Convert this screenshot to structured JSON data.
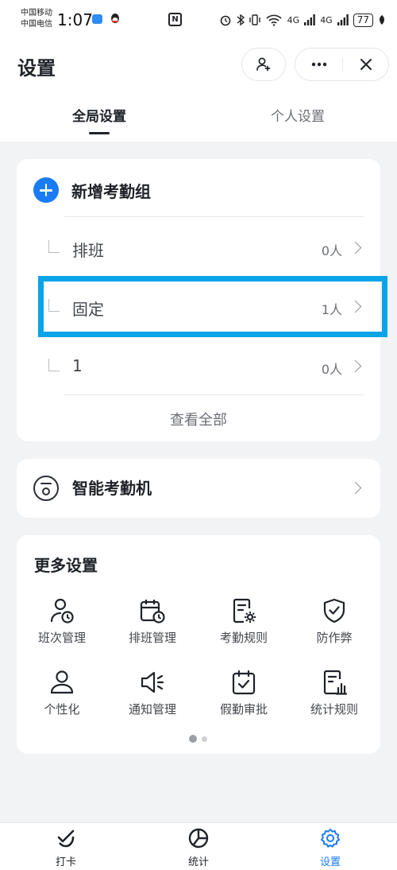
{
  "status_bar": {
    "carrier_1": "中国移动",
    "carrier_2": "中国电信",
    "time": "1:07",
    "signal_label_1": "4G",
    "signal_label_2": "4G",
    "battery": "77"
  },
  "header": {
    "title": "设置",
    "tabs": [
      {
        "label": "全局设置",
        "active": true
      },
      {
        "label": "个人设置",
        "active": false
      }
    ]
  },
  "groups_card": {
    "add_label": "新增考勤组",
    "groups": [
      {
        "name": "排班",
        "count": "0人"
      },
      {
        "name": "固定",
        "count": "1人"
      },
      {
        "name": "1",
        "count": "0人"
      }
    ],
    "view_all": "查看全部"
  },
  "machine_card": {
    "label": "智能考勤机"
  },
  "more_settings": {
    "title": "更多设置",
    "items": [
      {
        "label": "班次管理",
        "icon": "shift-icon"
      },
      {
        "label": "排班管理",
        "icon": "schedule-icon"
      },
      {
        "label": "考勤规则",
        "icon": "rules-icon"
      },
      {
        "label": "防作弊",
        "icon": "shield-icon"
      },
      {
        "label": "个性化",
        "icon": "person-icon"
      },
      {
        "label": "通知管理",
        "icon": "speaker-icon"
      },
      {
        "label": "假勤审批",
        "icon": "approval-icon"
      },
      {
        "label": "统计规则",
        "icon": "stats-icon"
      }
    ],
    "page_count": 2,
    "current_page": 1
  },
  "bottom_nav": {
    "items": [
      {
        "label": "打卡",
        "icon": "check-icon",
        "active": false
      },
      {
        "label": "统计",
        "icon": "pie-chart-icon",
        "active": false
      },
      {
        "label": "设置",
        "icon": "gear-icon",
        "active": true
      }
    ]
  },
  "colors": {
    "accent": "#1a7cf5",
    "highlight_border": "#0aa4e8",
    "background": "#f2f3f5"
  }
}
